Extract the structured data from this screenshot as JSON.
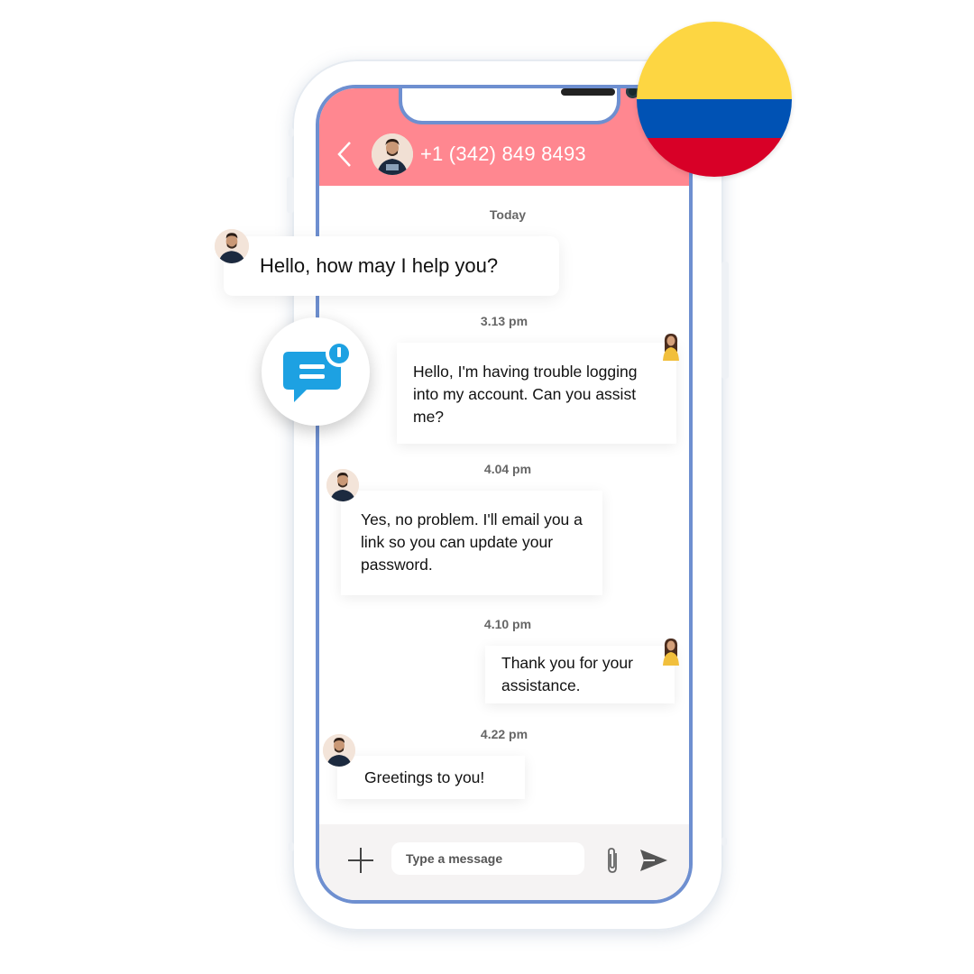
{
  "header": {
    "back_label": "<",
    "contact_number": "+1 (342) 849 8493"
  },
  "chat": {
    "date_label": "Today",
    "floating_message": "Hello, how may I help you?",
    "messages": [
      {
        "time": "3.13 pm",
        "sender": "user",
        "text": "Hello, I'm having trouble logging into my account. Can you assist me?"
      },
      {
        "time": "4.04 pm",
        "sender": "agent",
        "text": "Yes, no problem. I'll email you a link so you can update your password."
      },
      {
        "time": "4.10 pm",
        "sender": "user",
        "text": "Thank you for your assistance."
      },
      {
        "time": "4.22 pm",
        "sender": "agent",
        "text": "Greetings to you!"
      }
    ]
  },
  "input_bar": {
    "placeholder": "Type a message",
    "value": ""
  },
  "badge": {
    "notification_glyph": "!"
  },
  "flag": {
    "country": "Colombia",
    "colors": {
      "yellow": "#fdd642",
      "blue": "#0052b4",
      "red": "#d80027"
    }
  },
  "colors": {
    "header_bg": "#ff8790",
    "phone_border": "#6e8fd0",
    "chat_icon": "#1da1e2",
    "input_bar_bg": "#f5f3f3"
  }
}
